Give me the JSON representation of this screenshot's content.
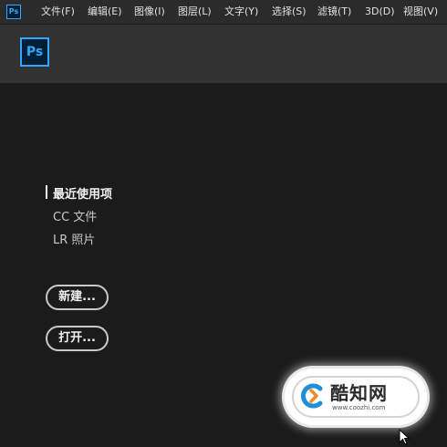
{
  "app": {
    "logo_text": "Ps",
    "accent_color": "#31a8ff"
  },
  "menubar": {
    "items": [
      {
        "label": "文件(F)"
      },
      {
        "label": "编辑(E)"
      },
      {
        "label": "图像(I)"
      },
      {
        "label": "图层(L)"
      },
      {
        "label": "文字(Y)"
      },
      {
        "label": "选择(S)"
      },
      {
        "label": "滤镜(T)"
      },
      {
        "label": "3D(D)"
      },
      {
        "label": "视图(V)"
      }
    ]
  },
  "header": {
    "logo_text": "Ps"
  },
  "home": {
    "nav": [
      {
        "label": "最近使用项",
        "active": true
      },
      {
        "label": "CC 文件",
        "active": false
      },
      {
        "label": "LR 照片",
        "active": false
      }
    ],
    "new_button": "新建...",
    "open_button": "打开..."
  },
  "watermark": {
    "name": "酷知网",
    "url": "www.coozhi.com"
  }
}
